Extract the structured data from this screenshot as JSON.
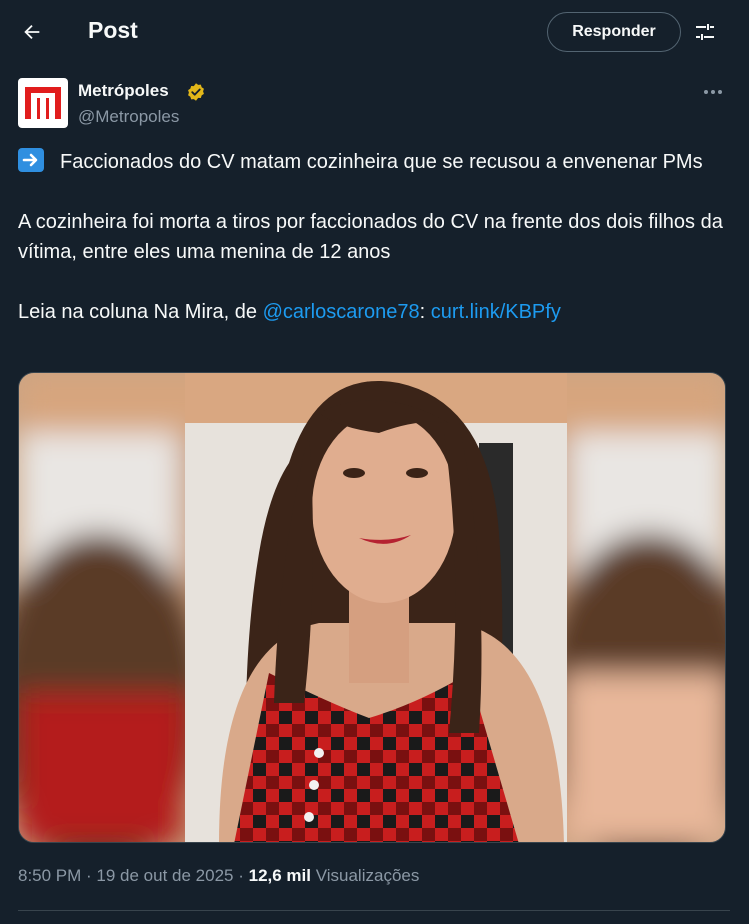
{
  "header": {
    "title": "Post",
    "reply_label": "Responder"
  },
  "author": {
    "name": "Metrópoles",
    "handle": "@Metropoles",
    "verified": true,
    "avatar_color": "#e11d1d"
  },
  "tweet": {
    "line1": "Faccionados do CV matam cozinheira que se recusou a envenenar PMs",
    "paragraph2": "A cozinheira foi morta a tiros por faccionados do CV na frente dos dois filhos da vítima, entre eles uma menina de 12 anos",
    "paragraph3_prefix": "Leia na coluna Na Mira, de ",
    "mention": "@carloscarone78",
    "separator": ": ",
    "link": "curt.link/KBPfy"
  },
  "meta": {
    "time": "8:50 PM",
    "dot": " · ",
    "date": "19 de out de 2025",
    "views_count": "12,6 mil",
    "views_label": "Visualizações"
  },
  "colors": {
    "background": "#15202b",
    "accent": "#1d9bf0",
    "muted": "#8b98a5",
    "verified_gold": "#e2b719"
  },
  "icons": [
    "back-arrow-icon",
    "settings-sliders-icon",
    "verified-badge-icon",
    "more-dots-icon",
    "right-arrow-emoji-icon"
  ]
}
